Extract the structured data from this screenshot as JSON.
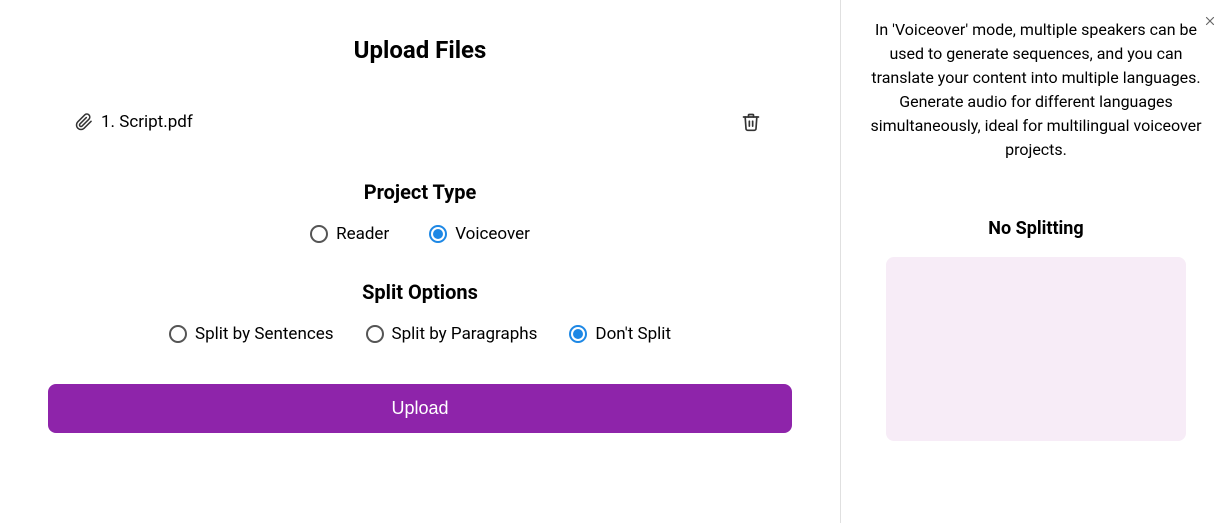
{
  "title": "Upload Files",
  "file": {
    "name": "1. Script.pdf"
  },
  "projectType": {
    "title": "Project Type",
    "options": [
      "Reader",
      "Voiceover"
    ],
    "selected": "Voiceover"
  },
  "splitOptions": {
    "title": "Split Options",
    "options": [
      "Split by Sentences",
      "Split by Paragraphs",
      "Don't Split"
    ],
    "selected": "Don't Split"
  },
  "uploadLabel": "Upload",
  "sidebar": {
    "description": "In 'Voiceover' mode, multiple speakers can be used to generate sequences, and you can translate your content into multiple languages. Generate audio for different languages simultaneously, ideal for multilingual voiceover projects.",
    "subtitle": "No Splitting"
  },
  "colors": {
    "accent": "#8e24aa",
    "radioSelected": "#1e88e5",
    "previewBg": "#f7ecf7"
  }
}
